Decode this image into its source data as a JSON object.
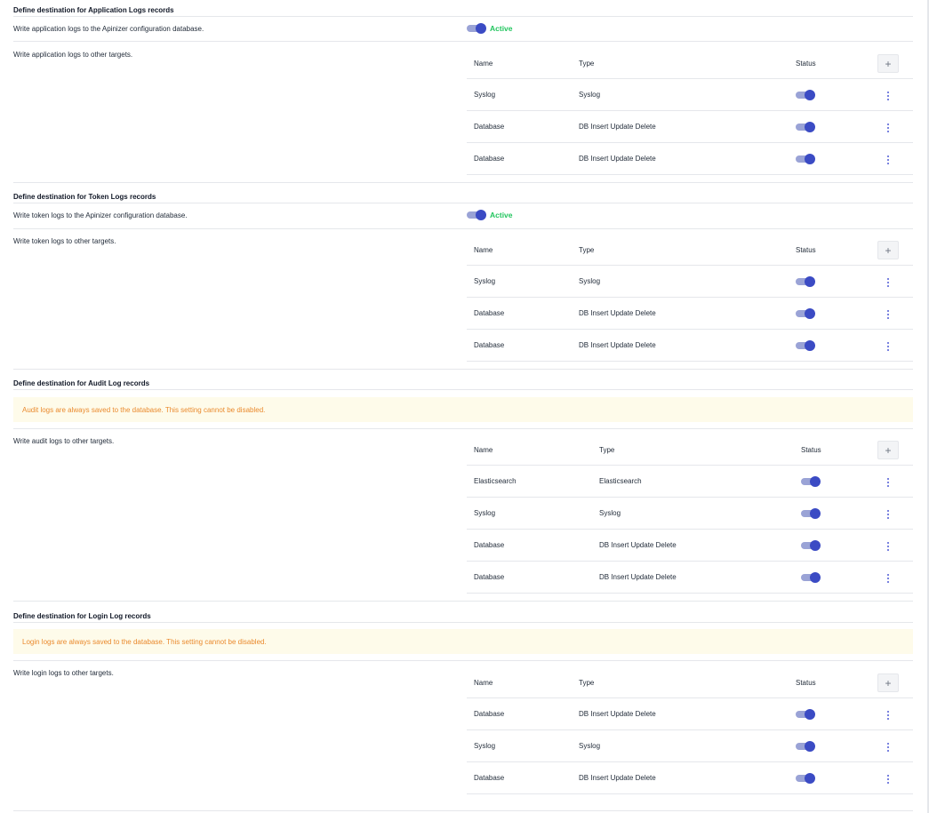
{
  "sections": {
    "app": {
      "title": "Define destination for Application Logs records",
      "db_text": "Write application logs to the Apinizer configuration database.",
      "db_status": "Active",
      "other_text": "Write application logs to other targets.",
      "headers": {
        "name": "Name",
        "type": "Type",
        "status": "Status"
      },
      "rows": [
        {
          "name": "Syslog",
          "type": "Syslog",
          "enabled": true
        },
        {
          "name": "Database",
          "type": "DB Insert Update Delete",
          "enabled": true
        },
        {
          "name": "Database",
          "type": "DB Insert Update Delete",
          "enabled": true
        }
      ]
    },
    "token": {
      "title": "Define destination for Token Logs records",
      "db_text": "Write token logs to the Apinizer configuration database.",
      "db_status": "Active",
      "other_text": "Write token logs to other targets.",
      "headers": {
        "name": "Name",
        "type": "Type",
        "status": "Status"
      },
      "rows": [
        {
          "name": "Syslog",
          "type": "Syslog",
          "enabled": true
        },
        {
          "name": "Database",
          "type": "DB Insert Update Delete",
          "enabled": true
        },
        {
          "name": "Database",
          "type": "DB Insert Update Delete",
          "enabled": true
        }
      ]
    },
    "audit": {
      "title": "Define destination for Audit Log records",
      "notice": "Audit logs are always saved to the database. This setting cannot be disabled.",
      "other_text": "Write audit logs to other targets.",
      "headers": {
        "name": "Name",
        "type": "Type",
        "status": "Status"
      },
      "rows": [
        {
          "name": "Elasticsearch",
          "type": "Elasticsearch",
          "enabled": true
        },
        {
          "name": "Syslog",
          "type": "Syslog",
          "enabled": true
        },
        {
          "name": "Database",
          "type": "DB Insert Update Delete",
          "enabled": true
        },
        {
          "name": "Database",
          "type": "DB Insert Update Delete",
          "enabled": true
        }
      ]
    },
    "login": {
      "title": "Define destination for Login Log records",
      "notice": "Login logs are always saved to the database. This setting cannot be disabled.",
      "other_text": "Write login logs to other targets.",
      "headers": {
        "name": "Name",
        "type": "Type",
        "status": "Status"
      },
      "rows": [
        {
          "name": "Database",
          "type": "DB Insert Update Delete",
          "enabled": true
        },
        {
          "name": "Syslog",
          "type": "Syslog",
          "enabled": true
        },
        {
          "name": "Database",
          "type": "DB Insert Update Delete",
          "enabled": true
        }
      ]
    }
  },
  "icons": {
    "add": "plus-icon",
    "menu": "kebab-menu-icon"
  },
  "colors": {
    "active_green": "#22c55e",
    "toggle_on": "#3b4bc4",
    "notice_bg": "#fefbea",
    "notice_text": "#ea8a2e"
  }
}
